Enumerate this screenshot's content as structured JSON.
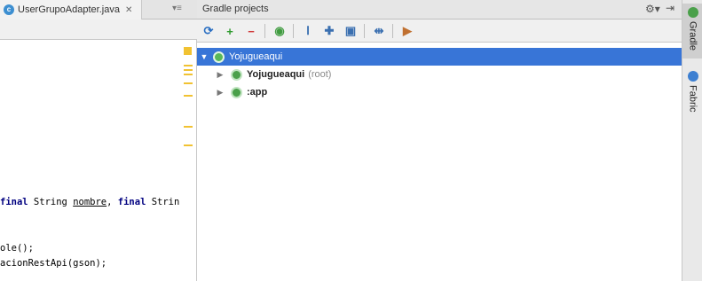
{
  "editor": {
    "tab": {
      "label": "UserGrupoAdapter.java",
      "close": "✕",
      "icon": "c",
      "menu": "▾≡"
    },
    "code_lines": [
      {
        "pre": "",
        "kw1": "final",
        "mid1": " String ",
        "ul": "nombre",
        "mid2": ", ",
        "kw2": "final",
        "post": " Strin"
      },
      {
        "text": "ole();"
      },
      {
        "text": "acionRestApi(gson);"
      }
    ]
  },
  "gradle": {
    "title": "Gradle projects",
    "header_icons": {
      "gear": "gear-icon",
      "hide": "hide-icon"
    },
    "toolbar": [
      {
        "name": "refresh-icon",
        "glyph": "⟳",
        "color": "#2b6fc2"
      },
      {
        "name": "add-icon",
        "glyph": "+",
        "color": "#2f9b2f"
      },
      {
        "name": "remove-icon",
        "glyph": "−",
        "color": "#d03a3a"
      },
      {
        "name": "execute-task-icon",
        "glyph": "◉",
        "color": "#3f9b3f"
      },
      {
        "name": "toggle-offline-icon",
        "glyph": "Ⅰ",
        "color": "#3a6fb0"
      },
      {
        "name": "expand-all-icon",
        "glyph": "✚",
        "color": "#3a6fb0"
      },
      {
        "name": "collapse-all-icon",
        "glyph": "▣",
        "color": "#3a6fb0"
      },
      {
        "name": "show-dependencies-icon",
        "glyph": "⇹",
        "color": "#3a6fb0"
      },
      {
        "name": "settings-icon",
        "glyph": "▶",
        "color": "#c07030"
      }
    ],
    "tree": [
      {
        "label": "Yojugueaqui",
        "sub": "",
        "expanded": true,
        "selected": true,
        "level": 0
      },
      {
        "label": "Yojugueaqui",
        "sub": "(root)",
        "expanded": false,
        "selected": false,
        "level": 1
      },
      {
        "label": ":app",
        "sub": "",
        "expanded": false,
        "selected": false,
        "level": 1
      }
    ]
  },
  "right_strip": {
    "tabs": [
      {
        "label": "Gradle",
        "active": true,
        "color": "#4aa04a"
      },
      {
        "label": "Fabric",
        "active": false,
        "color": "#3d7fd1"
      }
    ]
  }
}
